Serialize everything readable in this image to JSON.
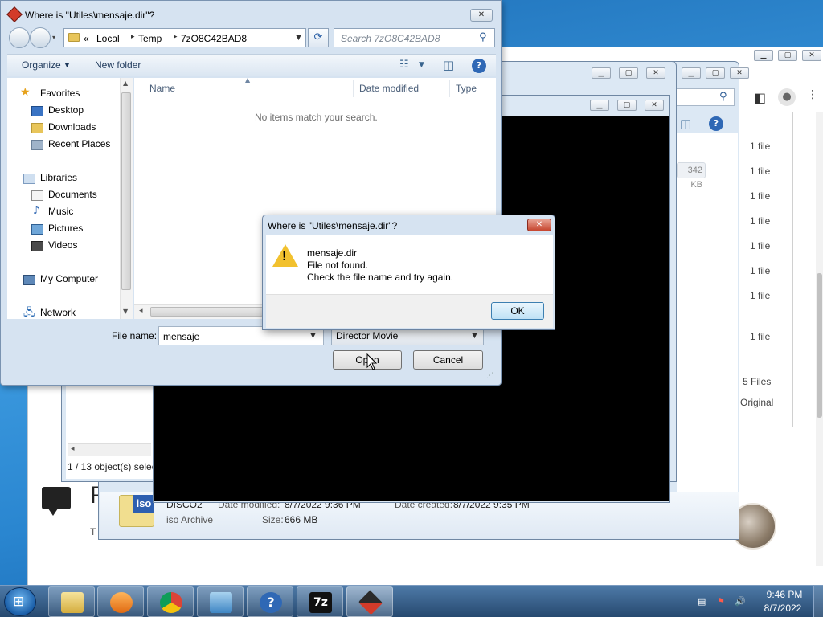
{
  "open_dialog": {
    "title": "Where is \"Utiles\\mensaje.dir\"?",
    "address": {
      "prefix": "«",
      "crumbs": [
        "Local",
        "Temp",
        "7zO8C42BAD8"
      ]
    },
    "search_placeholder": "Search 7zO8C42BAD8",
    "commands": {
      "organize": "Organize",
      "new_folder": "New folder"
    },
    "nav": {
      "favorites_header": "Favorites",
      "favorites": [
        "Desktop",
        "Downloads",
        "Recent Places"
      ],
      "libraries_header": "Libraries",
      "libraries": [
        "Documents",
        "Music",
        "Pictures",
        "Videos"
      ],
      "computer": "My Computer",
      "network": "Network"
    },
    "columns": [
      "Name",
      "Date modified",
      "Type"
    ],
    "empty_message": "No items match your search.",
    "file_name_label": "File name:",
    "file_name_value": "mensaje",
    "file_type_value": "Director Movie",
    "open_button": "Open",
    "cancel_button": "Cancel"
  },
  "error_box": {
    "title": "Where is \"Utiles\\mensaje.dir\"?",
    "lines": [
      "mensaje.dir",
      "File not found.",
      "Check the file name and try again."
    ],
    "ok_button": "OK"
  },
  "zip_window": {
    "size_pill": "342 KB",
    "details": {
      "name": "DISCO2",
      "type": "iso Archive",
      "date_modified_label": "Date modified:",
      "date_modified": "8/7/2022 9:36 PM",
      "date_created_label": "Date created:",
      "date_created": "8/7/2022 9:35 PM",
      "size_label": "Size:",
      "size": "666 MB"
    },
    "iso_badge": "iso"
  },
  "explorer_window": {
    "status": "1 / 13 object(s) selec"
  },
  "browser": {
    "side_items": [
      "1 file",
      "1 file",
      "1 file",
      "1 file",
      "1 file",
      "1 file",
      "1 file",
      "1 file"
    ],
    "side_summary": "5 Files",
    "side_original": "Original",
    "big_letter": "F",
    "small_letter": "T"
  },
  "taskbar": {
    "time": "9:46 PM",
    "date": "8/7/2022"
  },
  "colors": {
    "stage": "#000000",
    "dialog_chrome": "#d6e3f1",
    "taskbar": "#27496f",
    "warning": "#f2c12e"
  }
}
